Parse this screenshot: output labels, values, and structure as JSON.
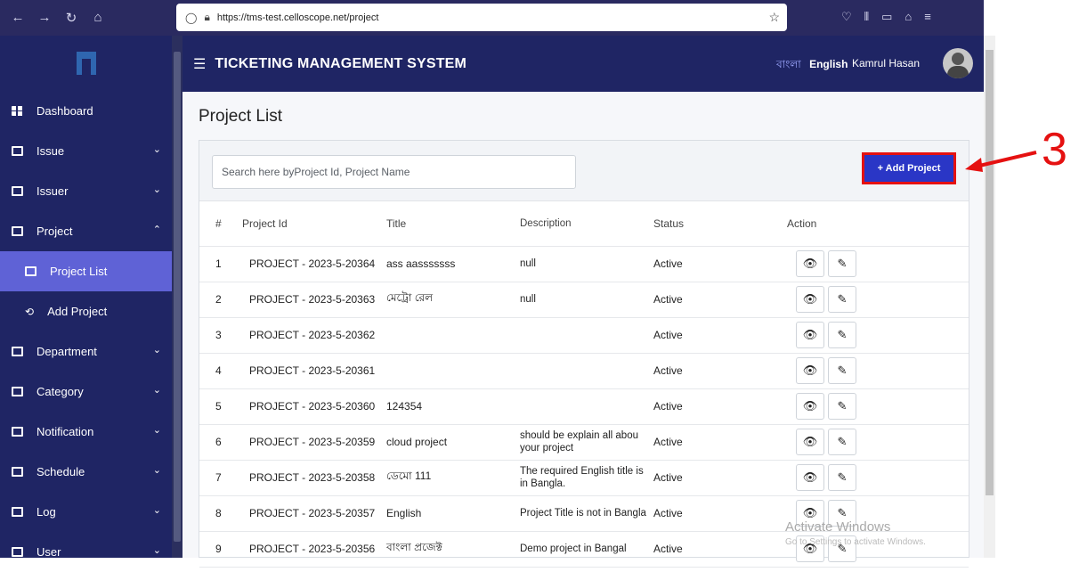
{
  "browser": {
    "url": "https://tms-test.celloscope.net/project"
  },
  "header": {
    "title": "TICKETING MANAGEMENT SYSTEM",
    "lang_bn": "বাংলা",
    "lang_en": "English",
    "user_name": "Kamrul Hasan"
  },
  "sidebar": {
    "items": [
      {
        "label": "Dashboard"
      },
      {
        "label": "Issue"
      },
      {
        "label": "Issuer"
      },
      {
        "label": "Project"
      },
      {
        "label": "Project List"
      },
      {
        "label": "Add Project"
      },
      {
        "label": "Department"
      },
      {
        "label": "Category"
      },
      {
        "label": "Notification"
      },
      {
        "label": "Schedule"
      },
      {
        "label": "Log"
      },
      {
        "label": "User"
      }
    ]
  },
  "main": {
    "page_title": "Project List",
    "search_placeholder": "Search here byProject Id, Project Name",
    "add_button": "+ Add Project",
    "columns": [
      "#",
      "Project Id",
      "Title",
      "Description",
      "Status",
      "Action"
    ],
    "rows": [
      {
        "num": "1",
        "id": "PROJECT - 2023-5-20364",
        "title": "ass aasssssss",
        "desc": "null",
        "status": "Active"
      },
      {
        "num": "2",
        "id": "PROJECT - 2023-5-20363",
        "title": "মেট্রো রেল",
        "desc": "null",
        "status": "Active"
      },
      {
        "num": "3",
        "id": "PROJECT - 2023-5-20362",
        "title": "",
        "desc": "",
        "status": "Active"
      },
      {
        "num": "4",
        "id": "PROJECT - 2023-5-20361",
        "title": "",
        "desc": "",
        "status": "Active"
      },
      {
        "num": "5",
        "id": "PROJECT - 2023-5-20360",
        "title": "124354",
        "desc": "",
        "status": "Active"
      },
      {
        "num": "6",
        "id": "PROJECT - 2023-5-20359",
        "title": "cloud project",
        "desc": "should be explain all abou your project",
        "status": "Active"
      },
      {
        "num": "7",
        "id": "PROJECT - 2023-5-20358",
        "title": "ডেমো 111",
        "desc": "The required English title is in Bangla.",
        "status": "Active"
      },
      {
        "num": "8",
        "id": "PROJECT - 2023-5-20357",
        "title": "English",
        "desc": "Project Title is not in Bangla",
        "status": "Active"
      },
      {
        "num": "9",
        "id": "PROJECT - 2023-5-20356",
        "title": "বাংলা প্রজেক্ট",
        "desc": "Demo project in Bangal",
        "status": "Active"
      }
    ]
  },
  "watermark": {
    "line1": "Activate Windows",
    "line2": "Go to Settings to activate Windows."
  },
  "annotation": {
    "number": "3",
    "color": "#e51111"
  },
  "colors": {
    "sidebar": "#1f2564",
    "active_item": "#5f62d6",
    "primary_button": "#2a36c6"
  }
}
